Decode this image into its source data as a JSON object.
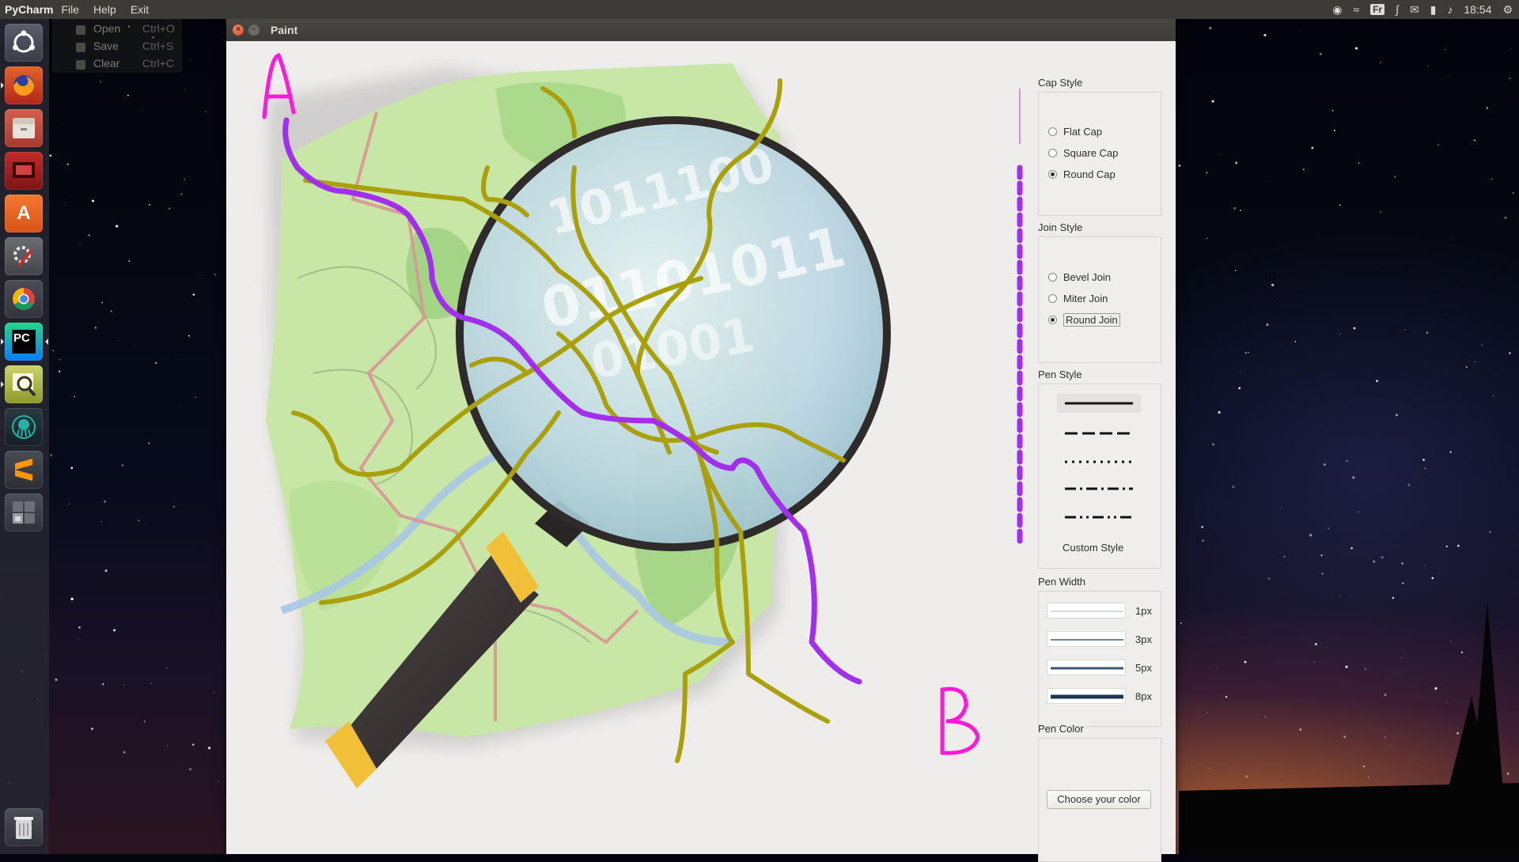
{
  "topbar": {
    "app_name": "PyCharm",
    "menus": [
      "File",
      "Help",
      "Exit"
    ],
    "keyboard_layout": "Fr",
    "clock": "18:54"
  },
  "file_menu": {
    "items": [
      {
        "label": "Open",
        "shortcut": "Ctrl+O"
      },
      {
        "label": "Save",
        "shortcut": "Ctrl+S"
      },
      {
        "label": "Clear",
        "shortcut": "Ctrl+C"
      }
    ]
  },
  "launcher": {
    "items": [
      {
        "name": "ubuntu-dash-icon"
      },
      {
        "name": "firefox-icon"
      },
      {
        "name": "files-icon"
      },
      {
        "name": "presentation-icon"
      },
      {
        "name": "software-center-icon"
      },
      {
        "name": "system-settings-icon"
      },
      {
        "name": "chrome-icon"
      },
      {
        "name": "pycharm-icon"
      },
      {
        "name": "image-viewer-icon"
      },
      {
        "name": "gitkraken-icon"
      },
      {
        "name": "sublime-text-icon"
      },
      {
        "name": "workspace-switcher-icon"
      },
      {
        "name": "trash-icon"
      }
    ]
  },
  "window": {
    "title": "Paint",
    "canvas_labels": {
      "start": "A",
      "end": "B"
    }
  },
  "panel": {
    "cap_style": {
      "title": "Cap Style",
      "options": [
        "Flat Cap",
        "Square Cap",
        "Round Cap"
      ],
      "selected": "Round Cap"
    },
    "join_style": {
      "title": "Join Style",
      "options": [
        "Bevel Join",
        "Miter Join",
        "Round Join"
      ],
      "selected": "Round Join"
    },
    "pen_style": {
      "title": "Pen Style",
      "options": [
        "solid",
        "dash",
        "dot",
        "dash-dot",
        "dash-dot-dot"
      ],
      "custom_label": "Custom Style"
    },
    "pen_width": {
      "title": "Pen Width",
      "options": [
        {
          "label": "1px",
          "value": 1
        },
        {
          "label": "3px",
          "value": 3
        },
        {
          "label": "5px",
          "value": 5
        },
        {
          "label": "8px",
          "value": 8
        }
      ]
    },
    "pen_color": {
      "title": "Pen Color",
      "button_label": "Choose your color"
    }
  },
  "colors": {
    "route_purple": "#a22ff0",
    "road_olive": "#aaa10a",
    "label_magenta": "#ff1ad9",
    "map_green": "#cbe7a9",
    "ubuntu_orange": "#e95420"
  }
}
